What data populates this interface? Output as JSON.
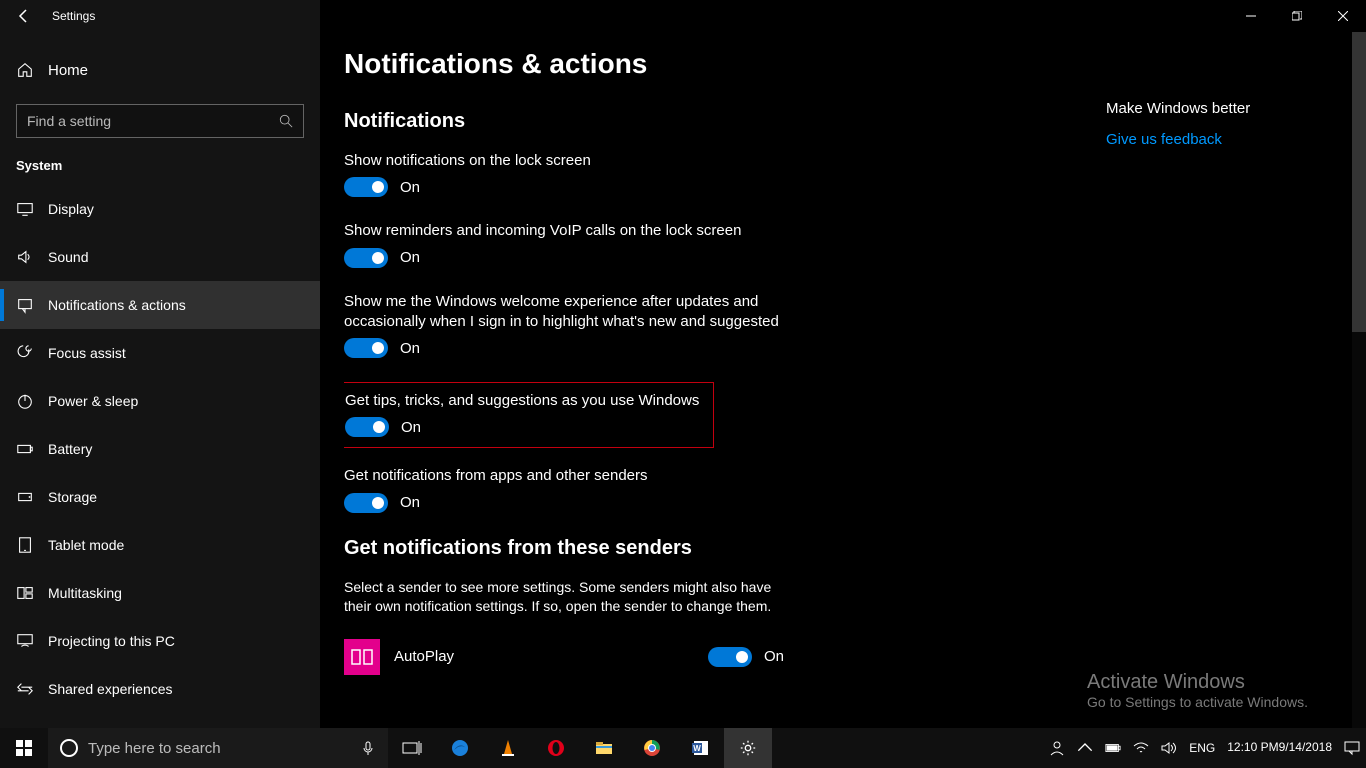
{
  "window": {
    "title": "Settings"
  },
  "sidebar": {
    "home": "Home",
    "search_placeholder": "Find a setting",
    "section": "System",
    "items": [
      {
        "label": "Display"
      },
      {
        "label": "Sound"
      },
      {
        "label": "Notifications & actions"
      },
      {
        "label": "Focus assist"
      },
      {
        "label": "Power & sleep"
      },
      {
        "label": "Battery"
      },
      {
        "label": "Storage"
      },
      {
        "label": "Tablet mode"
      },
      {
        "label": "Multitasking"
      },
      {
        "label": "Projecting to this PC"
      },
      {
        "label": "Shared experiences"
      }
    ]
  },
  "page": {
    "title": "Notifications & actions",
    "section1": "Notifications",
    "settings": [
      {
        "label": "Show notifications on the lock screen",
        "state": "On"
      },
      {
        "label": "Show reminders and incoming VoIP calls on the lock screen",
        "state": "On"
      },
      {
        "label": "Show me the Windows welcome experience after updates and occasionally when I sign in to highlight what's new and suggested",
        "state": "On"
      },
      {
        "label": "Get tips, tricks, and suggestions as you use Windows",
        "state": "On"
      },
      {
        "label": "Get notifications from apps and other senders",
        "state": "On"
      }
    ],
    "section2": "Get notifications from these senders",
    "senders_help": "Select a sender to see more settings. Some senders might also have their own notification settings. If so, open the sender to change them.",
    "senders": [
      {
        "name": "AutoPlay",
        "state": "On"
      }
    ]
  },
  "rightrail": {
    "title": "Make Windows better",
    "link": "Give us feedback"
  },
  "activate": {
    "title": "Activate Windows",
    "sub": "Go to Settings to activate Windows."
  },
  "taskbar": {
    "search_placeholder": "Type here to search",
    "language": "ENG",
    "time": "12:10 PM",
    "date": "9/14/2018"
  }
}
